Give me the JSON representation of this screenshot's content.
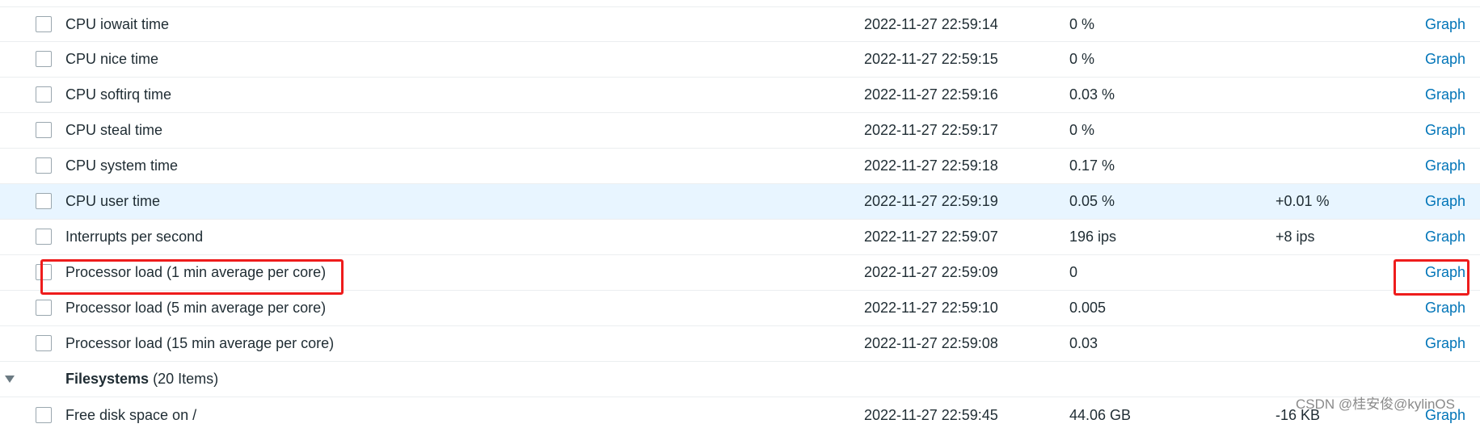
{
  "rows": [
    {
      "name": "CPU iowait time",
      "time": "2022-11-27 22:59:14",
      "value": "0 %",
      "change": "",
      "graph": "Graph"
    },
    {
      "name": "CPU nice time",
      "time": "2022-11-27 22:59:15",
      "value": "0 %",
      "change": "",
      "graph": "Graph"
    },
    {
      "name": "CPU softirq time",
      "time": "2022-11-27 22:59:16",
      "value": "0.03 %",
      "change": "",
      "graph": "Graph"
    },
    {
      "name": "CPU steal time",
      "time": "2022-11-27 22:59:17",
      "value": "0 %",
      "change": "",
      "graph": "Graph"
    },
    {
      "name": "CPU system time",
      "time": "2022-11-27 22:59:18",
      "value": "0.17 %",
      "change": "",
      "graph": "Graph"
    },
    {
      "name": "CPU user time",
      "time": "2022-11-27 22:59:19",
      "value": "0.05 %",
      "change": "+0.01 %",
      "graph": "Graph"
    },
    {
      "name": "Interrupts per second",
      "time": "2022-11-27 22:59:07",
      "value": "196 ips",
      "change": "+8 ips",
      "graph": "Graph"
    },
    {
      "name": "Processor load (1 min average per core)",
      "time": "2022-11-27 22:59:09",
      "value": "0",
      "change": "",
      "graph": "Graph"
    },
    {
      "name": "Processor load (5 min average per core)",
      "time": "2022-11-27 22:59:10",
      "value": "0.005",
      "change": "",
      "graph": "Graph"
    },
    {
      "name": "Processor load (15 min average per core)",
      "time": "2022-11-27 22:59:08",
      "value": "0.03",
      "change": "",
      "graph": "Graph"
    }
  ],
  "group": {
    "name": "Filesystems",
    "count": "(20 Items)"
  },
  "partial_row": {
    "name": "Free disk space on /",
    "time": "2022-11-27 22:59:45",
    "value": "44.06 GB",
    "change": "-16 KB",
    "graph": "Graph"
  },
  "watermark": "CSDN @桂安俊@kylinOS",
  "colors": {
    "link": "#0275b8",
    "highlight_row": "#e8f5ff",
    "annotation_box": "#ee1c1c"
  }
}
